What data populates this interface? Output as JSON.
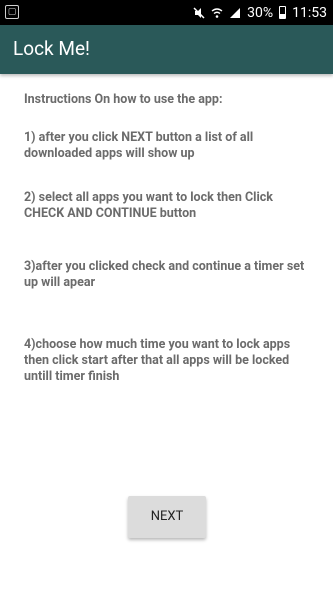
{
  "status_bar": {
    "time": "11:53",
    "battery_percent": "30%",
    "icons": [
      "notification-icon",
      "mute-icon",
      "wifi-icon",
      "signal-icon",
      "battery-icon"
    ]
  },
  "toolbar": {
    "title": "Lock Me!"
  },
  "instructions": {
    "heading": "Instructions On how to use the app:",
    "step1": "1) after you click NEXT button  a list of all downloaded apps will show up",
    "step2": "2) select all apps you want to lock then Click CHECK AND CONTINUE button",
    "step3": "3)after you clicked check and continue a timer set up will apear",
    "step4": "4)choose how much time you want to lock apps then click start after that all apps will be locked untill timer finish"
  },
  "actions": {
    "next_label": "NEXT"
  },
  "colors": {
    "toolbar": "#2a5959",
    "status_bar": "#000000",
    "text": "#6b6b6b",
    "button": "#dcdcdc"
  }
}
